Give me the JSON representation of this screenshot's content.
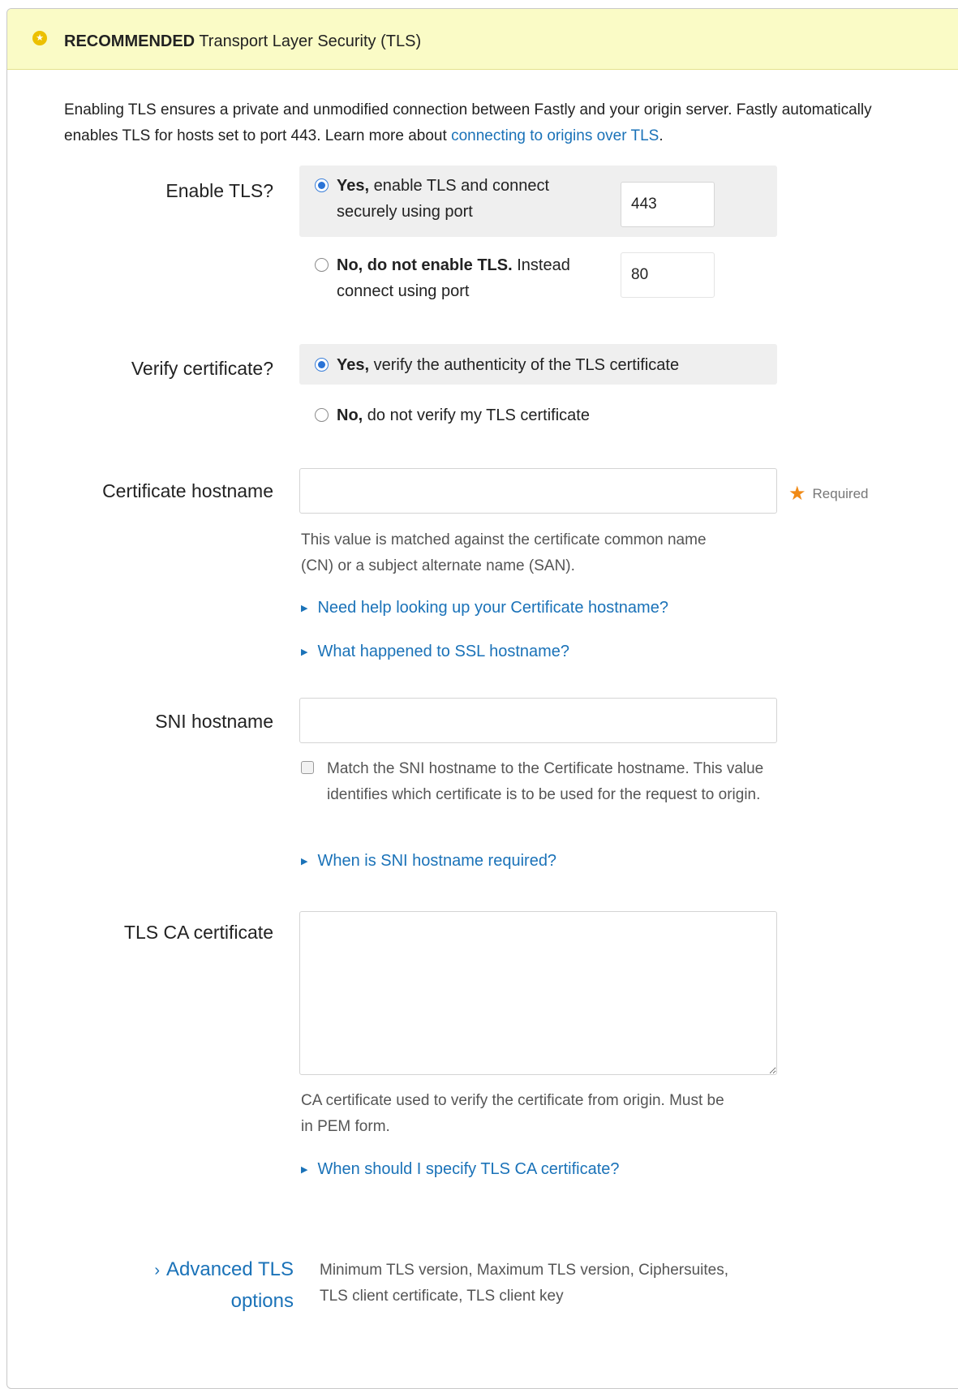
{
  "banner": {
    "badge": "RECOMMENDED",
    "title": "Transport Layer Security (TLS)",
    "icon": "star-circle-icon",
    "color": "#fafbc6"
  },
  "intro": {
    "text": "Enabling TLS ensures a private and unmodified connection between Fastly and your origin server. Fastly automatically enables TLS for hosts set to port 443. Learn more about ",
    "link": "connecting to origins over TLS",
    "end": "."
  },
  "enable_tls": {
    "label": "Enable TLS?",
    "yes_bold": "Yes,",
    "yes_text": " enable TLS and connect securely using port",
    "yes_port": "443",
    "no_bold": "No, do not enable TLS.",
    "no_text": " Instead connect using port",
    "no_port": "80",
    "selected": "yes"
  },
  "verify_cert": {
    "label": "Verify certificate?",
    "yes_bold": "Yes,",
    "yes_text": " verify the authenticity of the TLS certificate",
    "no_bold": "No,",
    "no_text": " do not verify my TLS certificate",
    "selected": "yes"
  },
  "cert_hostname": {
    "label": "Certificate hostname",
    "value": "",
    "required": "Required",
    "help": "This value is matched against the certificate common name (CN) or a subject alternate name (SAN).",
    "tip1": "Need help looking up your Certificate hostname?",
    "tip2": "What happened to SSL hostname?"
  },
  "sni_hostname": {
    "label": "SNI hostname",
    "value": "",
    "checkbox_text": "Match the SNI hostname to the Certificate hostname. This value identifies which certificate is to be used for the request to origin.",
    "checked": false,
    "tip": "When is SNI hostname required?"
  },
  "ca_cert": {
    "label": "TLS CA certificate",
    "value": "",
    "help": "CA certificate used to verify the certificate from origin. Must be in PEM form.",
    "tip": "When should I specify TLS CA certificate?"
  },
  "advanced": {
    "link": "Advanced TLS options",
    "desc": "Minimum TLS version, Maximum TLS version, Ciphersuites, TLS client certificate, TLS client key"
  },
  "colors": {
    "link": "#1a72b8",
    "radio_on": "#2a73d6",
    "required_star": "#f08a16"
  }
}
